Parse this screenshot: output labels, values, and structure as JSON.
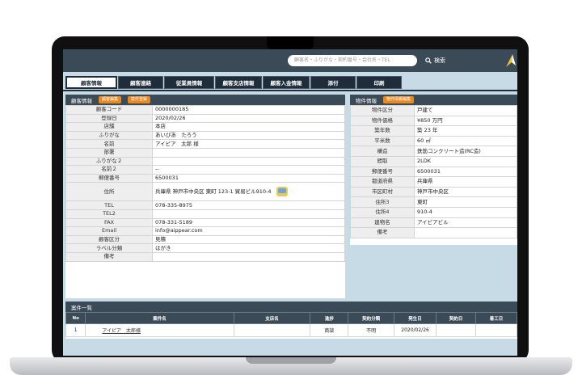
{
  "search": {
    "placeholder": "顧客名・ふりがな・契約番号・会社名・TEL",
    "button_label": "検索"
  },
  "tabs": [
    "顧客情報",
    "顧客連絡",
    "従業員情報",
    "顧客支店情報",
    "顧客入金情報",
    "添付",
    "印刷"
  ],
  "customer": {
    "title": "顧客情報",
    "buttons": [
      "顧客編集",
      "案件登録"
    ],
    "rows": [
      {
        "k": "顧客コード",
        "v": "0000000185"
      },
      {
        "k": "登録日",
        "v": "2020/02/26"
      },
      {
        "k": "店舗",
        "v": "本店"
      },
      {
        "k": "ふりがな",
        "v": "あいぴあ　たろう"
      },
      {
        "k": "名前",
        "v": "アイピア　太郎 様"
      },
      {
        "k": "部署",
        "v": ""
      },
      {
        "k": "ふりがな２",
        "v": ""
      },
      {
        "k": "名前２",
        "v": "--"
      },
      {
        "k": "郵便番号",
        "v": "6500031"
      },
      {
        "k": "住所",
        "v": "兵庫県 神戸市中央区 東町 123-1 貿易ビル910-4"
      },
      {
        "k": "TEL",
        "v": "078-335-8975"
      },
      {
        "k": "TEL2",
        "v": ""
      },
      {
        "k": "FAX",
        "v": "078-331-5189"
      },
      {
        "k": "Email",
        "v": "info@aippear.com"
      },
      {
        "k": "顧客区分",
        "v": "見積"
      },
      {
        "k": "ラベル分類",
        "v": "はがき"
      },
      {
        "k": "備考",
        "v": ""
      }
    ]
  },
  "property": {
    "title": "物件情報",
    "button": "物件情報編集",
    "rows": [
      {
        "k": "物件区分",
        "v": "戸建て"
      },
      {
        "k": "物件価格",
        "v": "¥850 万円"
      },
      {
        "k": "築年数",
        "v": "築 23 年"
      },
      {
        "k": "平米数",
        "v": "60 ㎡"
      },
      {
        "k": "構造",
        "v": "鉄筋コンクリート造(RC造)"
      },
      {
        "k": "間取",
        "v": "2LDK"
      },
      {
        "k": "郵便番号",
        "v": "6500031"
      },
      {
        "k": "都道府県",
        "v": "兵庫県"
      },
      {
        "k": "市区町村",
        "v": "神戸市中央区"
      },
      {
        "k": "住所3",
        "v": "東町"
      },
      {
        "k": "住所4",
        "v": "910-4"
      },
      {
        "k": "建物名",
        "v": "アイピアビル"
      },
      {
        "k": "備考",
        "v": ""
      }
    ]
  },
  "cases": {
    "title": "案件一覧",
    "headers": [
      "No",
      "案件名",
      "支店名",
      "進捗",
      "契約分類",
      "発生日",
      "契約日",
      "着工日"
    ],
    "rows": [
      [
        "1",
        "アイピア　太郎様",
        "",
        "商談",
        "不明",
        "2020/02/26",
        "",
        ""
      ]
    ]
  },
  "colors": {
    "header": "#3b4a57",
    "accent": "#e9891f",
    "background": "#c7dbe6"
  }
}
